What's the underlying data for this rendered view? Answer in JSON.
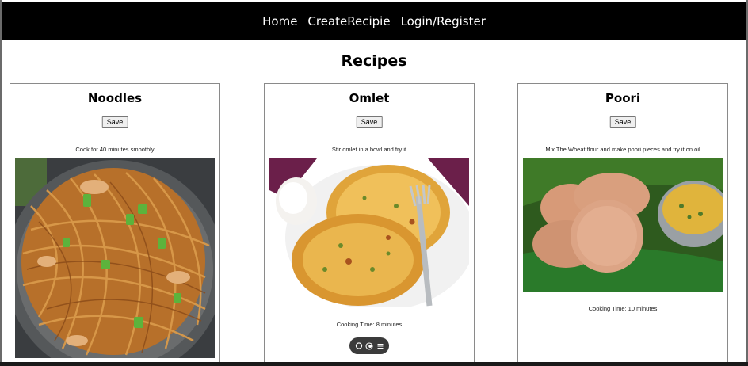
{
  "nav": {
    "home": "Home",
    "create": "CreateRecipie",
    "login": "Login/Register"
  },
  "page": {
    "title": "Recipes"
  },
  "recipes": [
    {
      "title": "Noodles",
      "save_label": "Save",
      "description": "Cook for 40 minutes smoothly",
      "image_icon": "noodles-photo",
      "cooking_time": ""
    },
    {
      "title": "Omlet",
      "save_label": "Save",
      "description": "Stir omlet in a bowl and fry it",
      "image_icon": "omelette-photo",
      "cooking_time": "Cooking Time: 8 minutes"
    },
    {
      "title": "Poori",
      "save_label": "Save",
      "description": "Mix The Wheat flour and make poori pieces and fry it on oil",
      "image_icon": "poori-photo",
      "cooking_time": "Cooking Time: 10 minutes"
    }
  ],
  "toolbar": {
    "icons": [
      "comment-icon",
      "toggle-icon",
      "menu-icon"
    ]
  },
  "colors": {
    "navbar_bg": "#000000",
    "nav_text": "#ffffff",
    "card_border": "#8a8a8a"
  }
}
